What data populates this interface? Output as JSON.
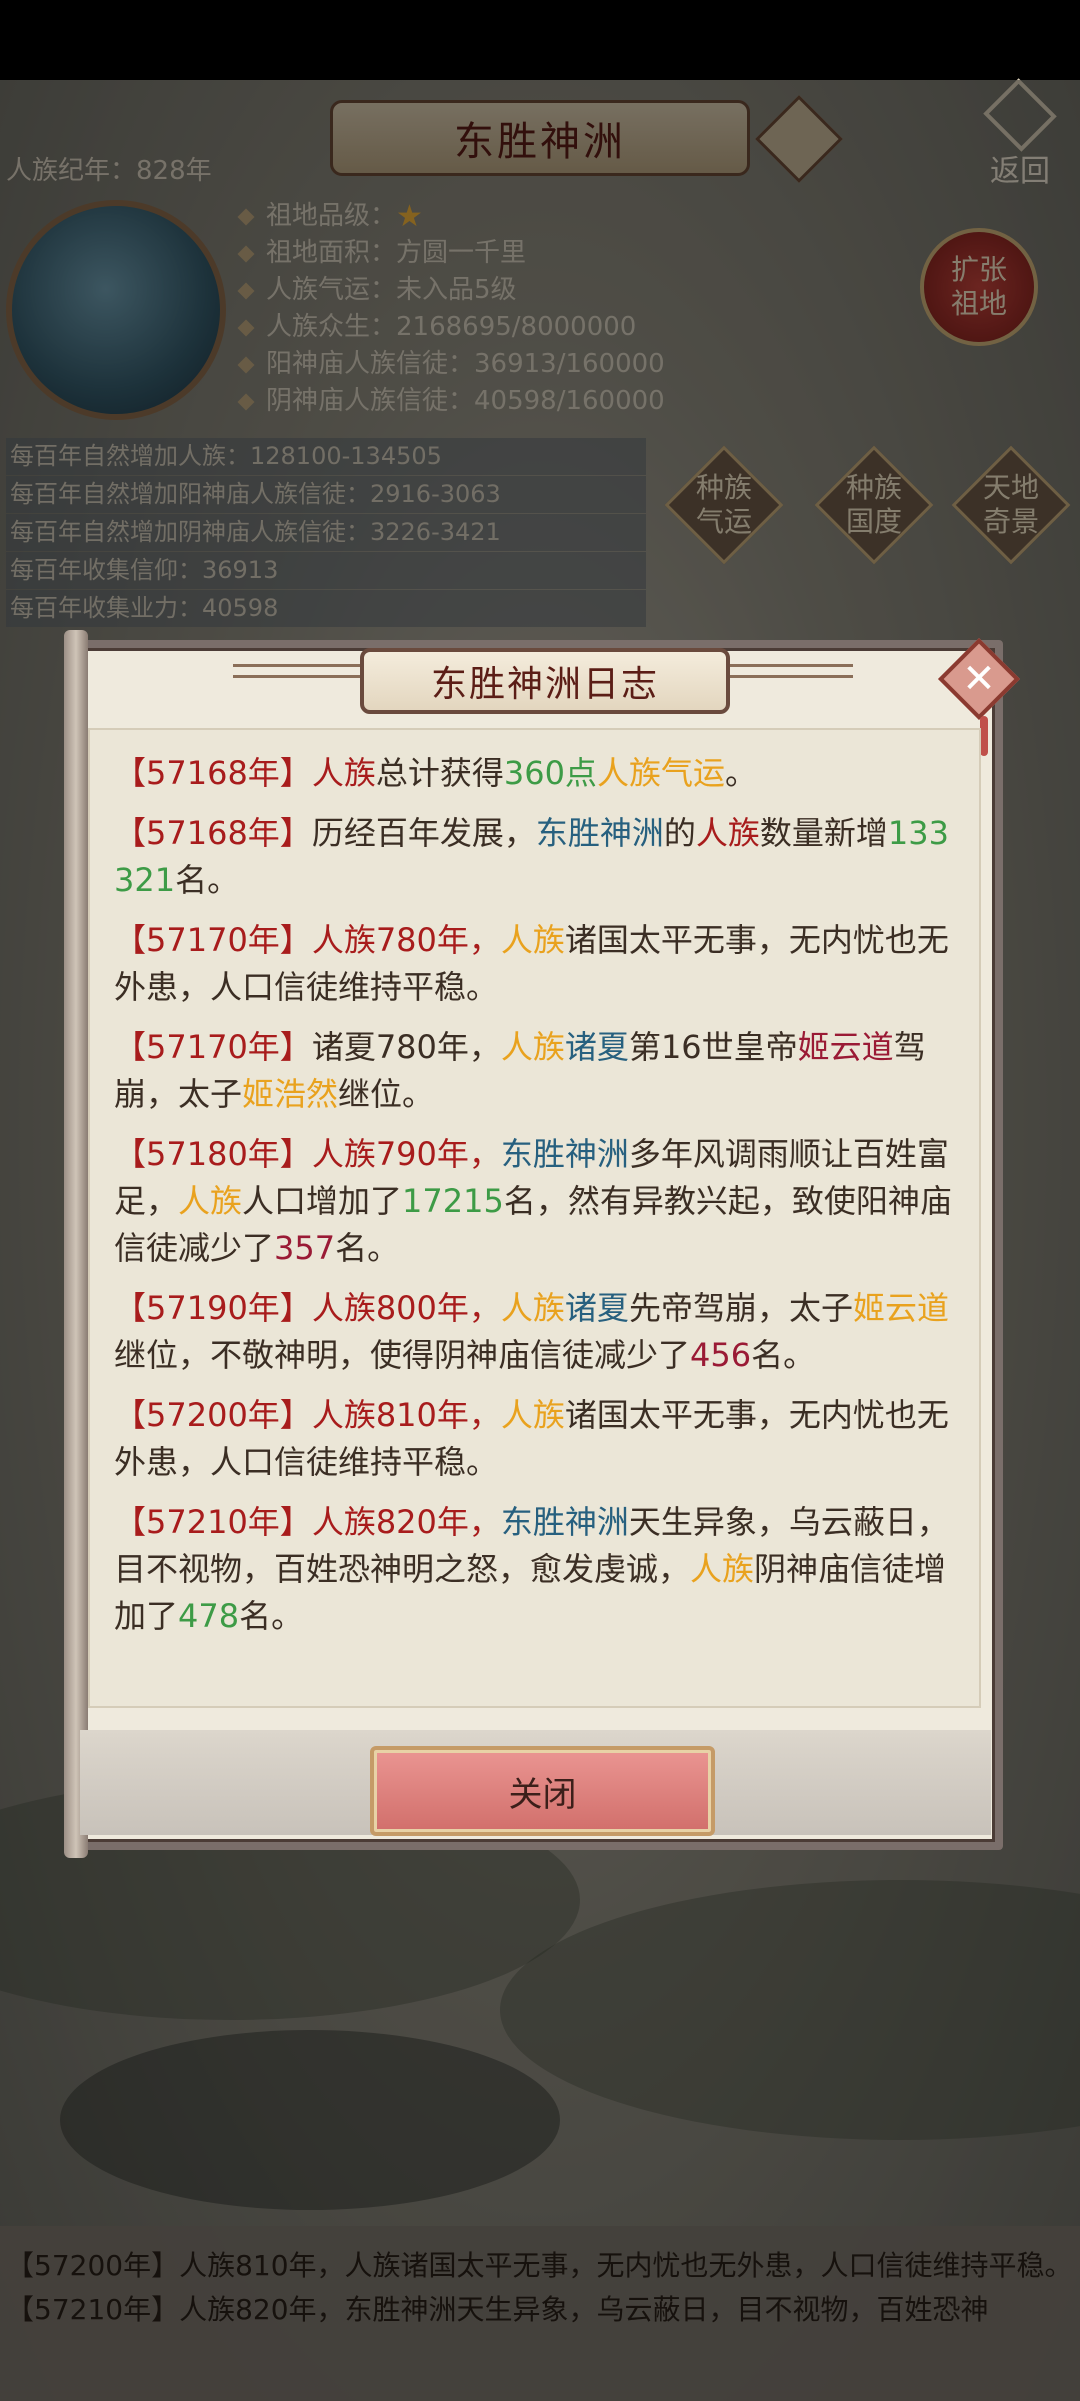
{
  "header": {
    "title": "东胜神洲",
    "era": "人族纪年：828年",
    "back_label": "返回"
  },
  "info": {
    "grade_label": "祖地品级：",
    "grade_star": "★",
    "area": "祖地面积：方圆一千里",
    "luck": "人族气运：未入品5级",
    "population": "人族众生：2168695/8000000",
    "yang_temple": "阳神庙人族信徒：36913/160000",
    "yin_temple": "阴神庙人族信徒：40598/160000",
    "expand_label": "扩张\n祖地"
  },
  "stats": [
    "每百年自然增加人族：128100-134505",
    "每百年自然增加阳神庙人族信徒：2916-3063",
    "每百年自然增加阴神庙人族信徒：3226-3421",
    "每百年收集信仰：36913",
    "每百年收集业力：40598"
  ],
  "side_buttons": {
    "race_luck": "种族\n气运",
    "race_nation": "种族\n国度",
    "heaven_earth": "天地\n奇景"
  },
  "dialog": {
    "title": "东胜神洲日志",
    "close_label": "关闭",
    "entries": [
      [
        {
          "t": "【57168年】",
          "c": "red"
        },
        {
          "t": "人族",
          "c": "red"
        },
        {
          "t": "总计获得",
          "c": ""
        },
        {
          "t": "360点",
          "c": "green"
        },
        {
          "t": "人族气运",
          "c": "orange"
        },
        {
          "t": "。",
          "c": ""
        }
      ],
      [
        {
          "t": "【57168年】",
          "c": "red"
        },
        {
          "t": "历经百年发展，",
          "c": ""
        },
        {
          "t": "东胜神洲",
          "c": "blue"
        },
        {
          "t": "的",
          "c": ""
        },
        {
          "t": "人族",
          "c": "red"
        },
        {
          "t": "数量新增",
          "c": ""
        },
        {
          "t": "133321",
          "c": "green"
        },
        {
          "t": "名。",
          "c": ""
        }
      ],
      [
        {
          "t": "【57170年】",
          "c": "red"
        },
        {
          "t": "人族780年，",
          "c": "red"
        },
        {
          "t": "人族",
          "c": "orange"
        },
        {
          "t": "诸国太平无事，无内忧也无外患，人口信徒维持平稳。",
          "c": ""
        }
      ],
      [
        {
          "t": "【57170年】",
          "c": "red"
        },
        {
          "t": "诸夏780年，",
          "c": ""
        },
        {
          "t": "人族",
          "c": "orange"
        },
        {
          "t": "诸夏",
          "c": "blue"
        },
        {
          "t": "第16世皇帝",
          "c": ""
        },
        {
          "t": "姬云道",
          "c": "maroon"
        },
        {
          "t": "驾崩，太子",
          "c": ""
        },
        {
          "t": "姬浩然",
          "c": "orange"
        },
        {
          "t": "继位。",
          "c": ""
        }
      ],
      [
        {
          "t": "【57180年】",
          "c": "red"
        },
        {
          "t": "人族790年，",
          "c": "red"
        },
        {
          "t": "东胜神洲",
          "c": "blue"
        },
        {
          "t": "多年风调雨顺让百姓富足，",
          "c": ""
        },
        {
          "t": "人族",
          "c": "orange"
        },
        {
          "t": "人口增加了",
          "c": ""
        },
        {
          "t": "17215",
          "c": "green"
        },
        {
          "t": "名，然有异教兴起，致使阳神庙信徒减少了",
          "c": ""
        },
        {
          "t": "357",
          "c": "maroon"
        },
        {
          "t": "名。",
          "c": ""
        }
      ],
      [
        {
          "t": "【57190年】",
          "c": "red"
        },
        {
          "t": "人族800年，",
          "c": "red"
        },
        {
          "t": "人族",
          "c": "orange"
        },
        {
          "t": "诸夏",
          "c": "blue"
        },
        {
          "t": "先帝驾崩，太子",
          "c": ""
        },
        {
          "t": "姬云道",
          "c": "orange"
        },
        {
          "t": "继位，不敬神明，使得阴神庙信徒减少了",
          "c": ""
        },
        {
          "t": "456",
          "c": "maroon"
        },
        {
          "t": "名。",
          "c": ""
        }
      ],
      [
        {
          "t": "【57200年】",
          "c": "red"
        },
        {
          "t": "人族810年，",
          "c": "red"
        },
        {
          "t": "人族",
          "c": "orange"
        },
        {
          "t": "诸国太平无事，无内忧也无外患，人口信徒维持平稳。",
          "c": ""
        }
      ],
      [
        {
          "t": "【57210年】",
          "c": "red"
        },
        {
          "t": "人族820年，",
          "c": "red"
        },
        {
          "t": "东胜神洲",
          "c": "blue"
        },
        {
          "t": "天生异象，乌云蔽日，目不视物，百姓恐神明之怒，愈发虔诚，",
          "c": ""
        },
        {
          "t": "人族",
          "c": "orange"
        },
        {
          "t": "阴神庙信徒增加了",
          "c": ""
        },
        {
          "t": "478",
          "c": "green"
        },
        {
          "t": "名。",
          "c": ""
        }
      ]
    ]
  },
  "bottom_log": [
    "【57200年】人族810年，人族诸国太平无事，无内忧也无外患，人口信徒维持平稳。",
    "【57210年】人族820年，东胜神洲天生异象，乌云蔽日，目不视物，百姓恐神"
  ],
  "colors": {
    "red": "#a81c1c",
    "orange": "#e9a21e",
    "green": "#3d9b46",
    "blue": "#27607f",
    "maroon": "#9a1a35",
    "close_button": "#d16f6b"
  }
}
